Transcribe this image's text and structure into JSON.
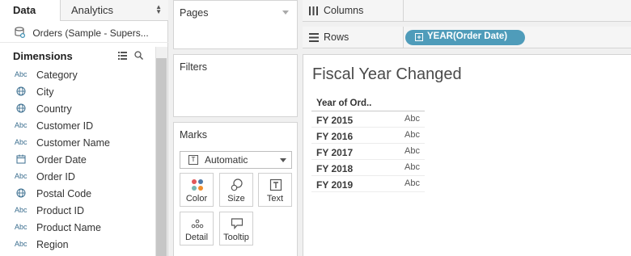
{
  "tabs": {
    "data": "Data",
    "analytics": "Analytics"
  },
  "datasource": {
    "name": "Orders (Sample - Supers..."
  },
  "dimensions": {
    "title": "Dimensions",
    "items": [
      {
        "type": "Abc",
        "label": "Category"
      },
      {
        "type": "geo",
        "label": "City"
      },
      {
        "type": "geo",
        "label": "Country"
      },
      {
        "type": "Abc",
        "label": "Customer ID"
      },
      {
        "type": "Abc",
        "label": "Customer Name"
      },
      {
        "type": "cal",
        "label": "Order Date"
      },
      {
        "type": "Abc",
        "label": "Order ID"
      },
      {
        "type": "geo",
        "label": "Postal Code"
      },
      {
        "type": "Abc",
        "label": "Product ID"
      },
      {
        "type": "Abc",
        "label": "Product Name"
      },
      {
        "type": "Abc",
        "label": "Region"
      }
    ]
  },
  "cards": {
    "pages": "Pages",
    "filters": "Filters",
    "marks": "Marks"
  },
  "marks": {
    "type": "Automatic",
    "buttons": {
      "color": "Color",
      "size": "Size",
      "text": "Text",
      "detail": "Detail",
      "tooltip": "Tooltip"
    }
  },
  "shelves": {
    "columns": "Columns",
    "rows": "Rows",
    "rows_pill": "YEAR(Order Date)"
  },
  "view": {
    "title": "Fiscal Year Changed",
    "table": {
      "header": "Year of Ord..",
      "rows": [
        {
          "year": "FY 2015",
          "value": "Abc"
        },
        {
          "year": "FY 2016",
          "value": "Abc"
        },
        {
          "year": "FY 2017",
          "value": "Abc"
        },
        {
          "year": "FY 2018",
          "value": "Abc"
        },
        {
          "year": "FY 2019",
          "value": "Abc"
        }
      ]
    }
  },
  "colors": {
    "pill": "#4f9cba",
    "type_icon": "#3b6e8f"
  }
}
